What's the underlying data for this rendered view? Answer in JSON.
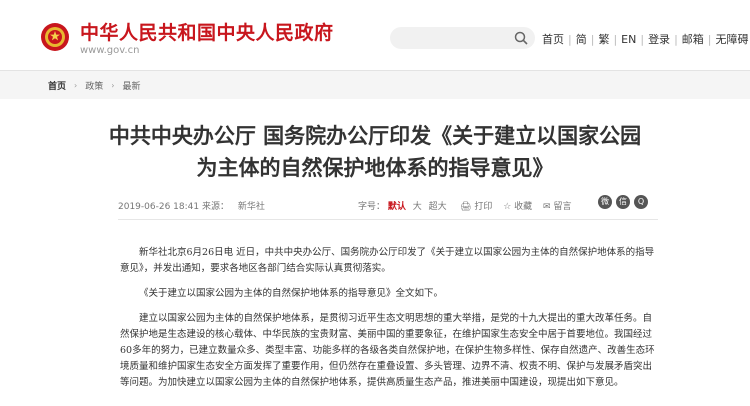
{
  "header": {
    "site_name": "中华人民共和国中央人民政府",
    "site_url": "www.gov.cn",
    "nav": [
      "首页",
      "简",
      "繁",
      "EN",
      "登录",
      "邮箱",
      "无障碍"
    ]
  },
  "breadcrumb": {
    "home": "首页",
    "level1": "政策",
    "level2": "最新"
  },
  "article": {
    "title": "中共中央办公厅 国务院办公厅印发《关于建立以国家公园为主体的自然保护地体系的指导意见》",
    "date": "2019-06-26 18:41",
    "source_label": "来源：",
    "source": "新华社",
    "font_label": "字号：",
    "font_default": "默认",
    "font_large": "大",
    "font_xlarge": "超大",
    "print": "打印",
    "favorite": "收藏",
    "comment": "留言",
    "paragraphs": [
      "新华社北京6月26日电 近日，中共中央办公厅、国务院办公厅印发了《关于建立以国家公园为主体的自然保护地体系的指导意见》，并发出通知，要求各地区各部门结合实际认真贯彻落实。",
      "《关于建立以国家公园为主体的自然保护地体系的指导意见》全文如下。",
      "建立以国家公园为主体的自然保护地体系，是贯彻习近平生态文明思想的重大举措，是党的十九大提出的重大改革任务。自然保护地是生态建设的核心载体、中华民族的宝贵财富、美丽中国的重要象征，在维护国家生态安全中居于首要地位。我国经过60多年的努力，已建立数量众多、类型丰富、功能多样的各级各类自然保护地，在保护生物多样性、保存自然遗产、改善生态环境质量和维护国家生态安全方面发挥了重要作用，但仍然存在重叠设置、多头管理、边界不清、权责不明、保护与发展矛盾突出等问题。为加快建立以国家公园为主体的自然保护地体系，提供高质量生态产品，推进美丽中国建设，现提出如下意见。"
    ]
  },
  "colors": {
    "brand": "#c8161d"
  },
  "icons": {
    "logo": "national-emblem-icon",
    "search": "search-icon",
    "share": [
      "weibo-icon",
      "wechat-icon",
      "qq-icon"
    ]
  }
}
